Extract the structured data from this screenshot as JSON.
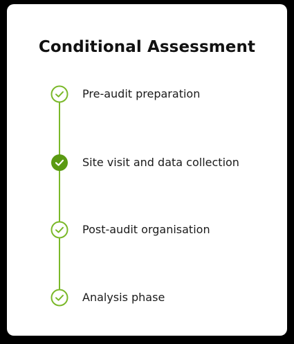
{
  "card": {
    "title": "Conditional Assessment"
  },
  "steps": [
    {
      "label": "Pre-audit preparation",
      "status": "complete",
      "icon": "check-circle-outline-icon"
    },
    {
      "label": "Site visit and data collection",
      "status": "current",
      "icon": "check-circle-filled-icon"
    },
    {
      "label": "Post-audit organisation",
      "status": "complete",
      "icon": "check-circle-outline-icon"
    },
    {
      "label": "Analysis phase",
      "status": "complete",
      "icon": "check-circle-outline-icon"
    }
  ],
  "colors": {
    "accent": "#7ab829",
    "accent_dark": "#5a9a12",
    "background": "#000000",
    "card": "#ffffff",
    "text": "#1a1a1a"
  }
}
